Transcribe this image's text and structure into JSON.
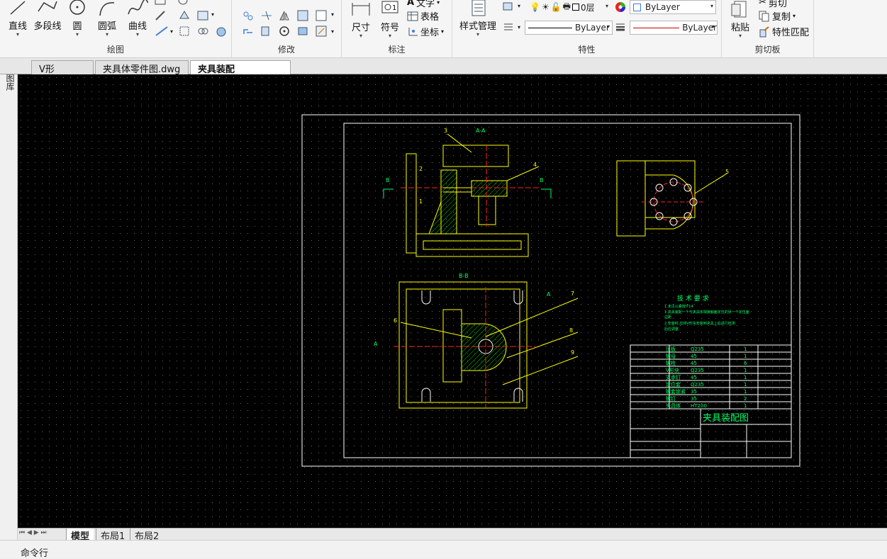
{
  "ribbon": {
    "draw": {
      "label": "绘图",
      "tools": [
        "直线",
        "多段线",
        "圆",
        "圆弧",
        "曲线"
      ]
    },
    "modify": {
      "label": "修改"
    },
    "annotate": {
      "label": "标注",
      "dimension": "尺寸",
      "symbol": "符号",
      "text": "文字",
      "table": "表格",
      "coordinate": "坐标"
    },
    "properties": {
      "label": "特性",
      "style_manager": "样式管理",
      "layer": "0层",
      "color": "ByLayer",
      "linetype": "ByLayer",
      "lineweight": "ByLayer"
    },
    "clipboard": {
      "label": "剪切板",
      "paste": "粘贴",
      "cut": "剪切",
      "copy": "复制",
      "match": "特性匹配"
    }
  },
  "doc_tabs": [
    {
      "label": "V形块.dwg"
    },
    {
      "label": "夹具体零件图.dwg"
    },
    {
      "label": "夹具装配图.dwg",
      "close": "×"
    }
  ],
  "left_panel": {
    "label": "图库"
  },
  "layout_tabs": [
    "模型",
    "布局1",
    "布局2"
  ],
  "nav_arrows": "⏮ ◀ ▶ ⏭",
  "command_line": "命令行",
  "drawing": {
    "section_aa": "A-A",
    "section_bb": "B-B",
    "label_b": "B",
    "label_a": "A",
    "balloons": [
      "1",
      "2",
      "3",
      "4",
      "5",
      "6",
      "7",
      "8",
      "9"
    ],
    "tech_title": "技 术 要 求",
    "tech_lines": [
      "1.未注公差按IT14",
      "1.夹具装配一个与夹具体相接触面定位的另一个定位面",
      "边距",
      "2.安装时,应将V形块安装到夹具上后进行检测",
      "后应调整"
    ],
    "title": "夹具装配图",
    "bom_rows": [
      [
        "压板",
        "Q235",
        "1"
      ],
      [
        "螺母",
        "45",
        "1"
      ],
      [
        "螺栓",
        "45",
        "6"
      ],
      [
        "V形块",
        "Q235",
        "1"
      ],
      [
        "支承钉",
        "45",
        "1"
      ],
      [
        "定位套",
        "Q235",
        "1"
      ],
      [
        "螺套锁紧",
        "35",
        "1"
      ],
      [
        "螺钉",
        "35",
        "2"
      ],
      [
        "夹具体",
        "HT200",
        "1"
      ]
    ]
  },
  "colors": {
    "canvas": "#000000",
    "frame": "#ffffff",
    "geometry": "#ffff00",
    "hatch": "#00cc00",
    "centerline": "#ff2020",
    "text": "#00ff66"
  }
}
